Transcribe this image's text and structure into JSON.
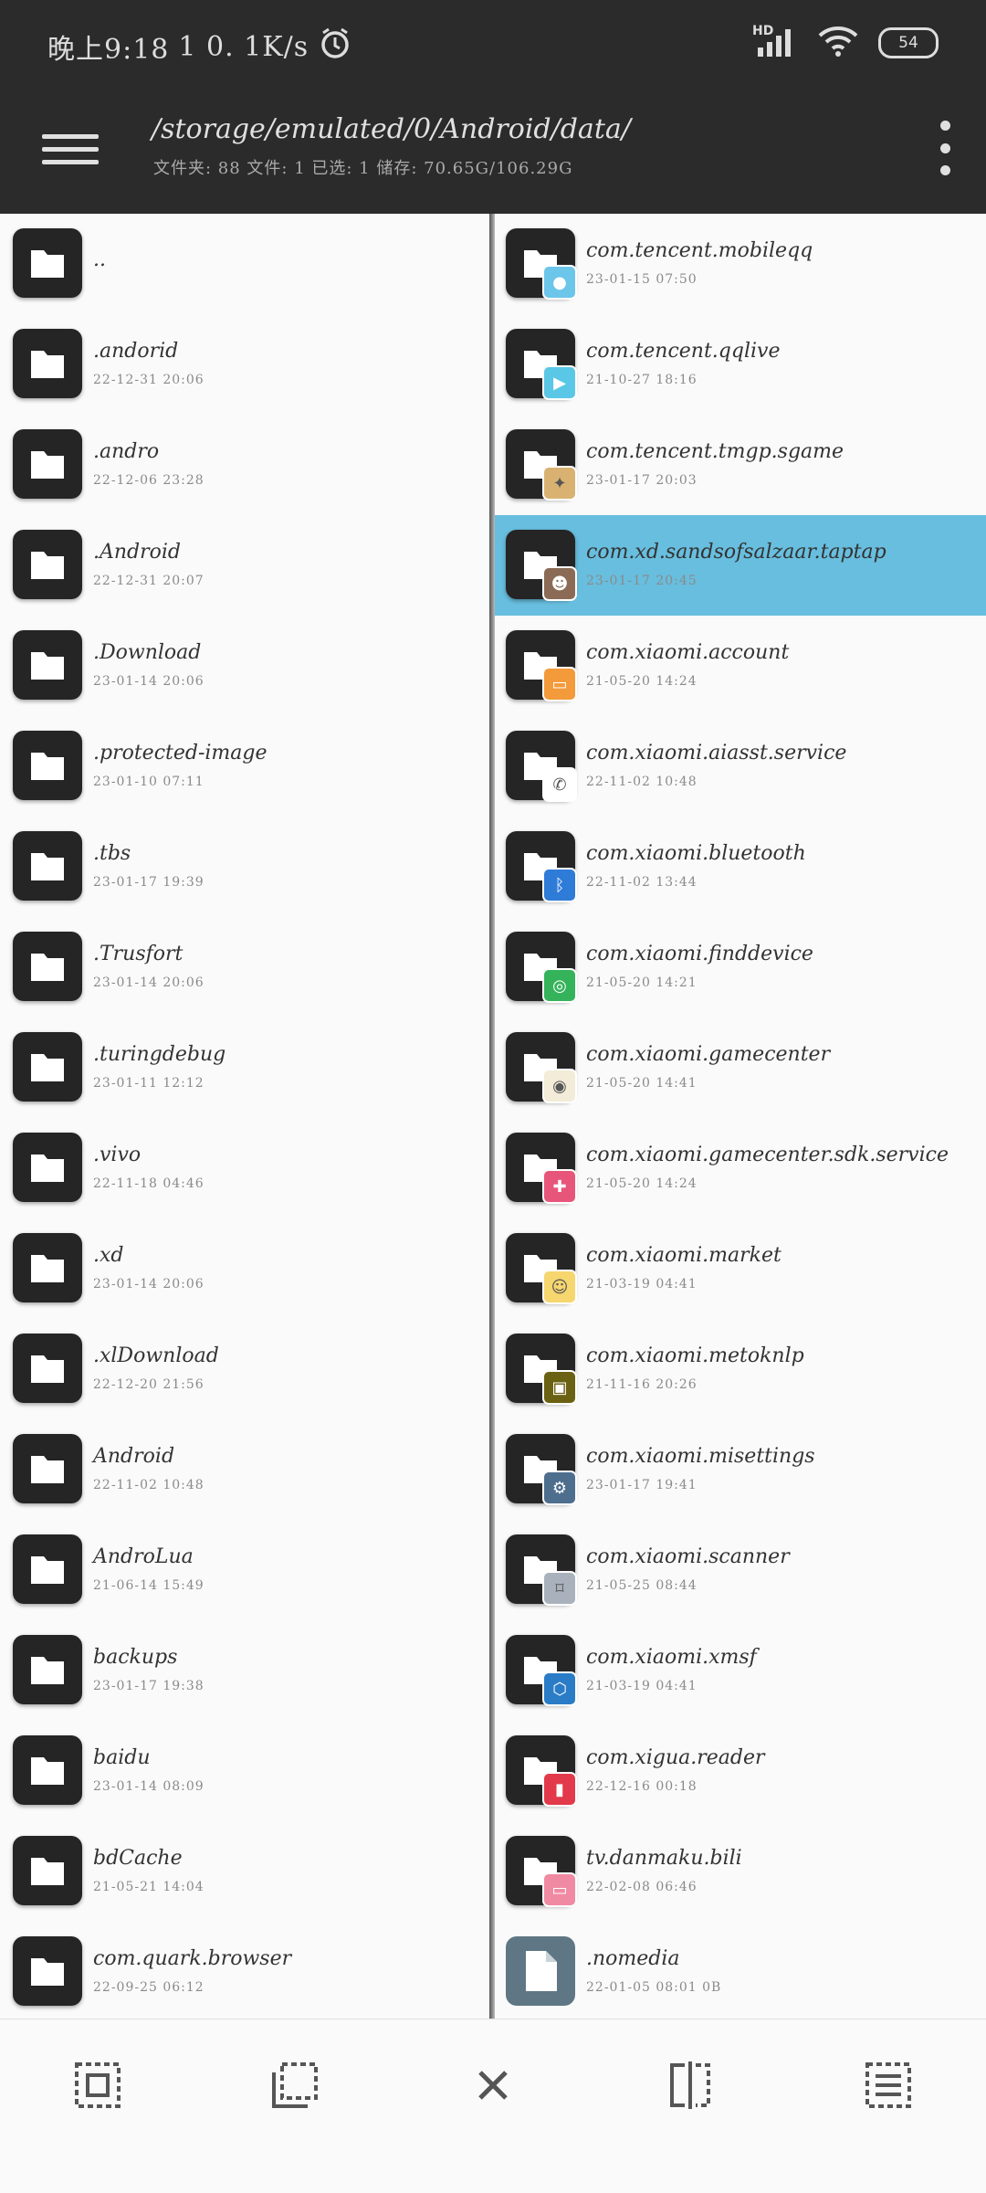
{
  "status_bar": {
    "time": "晚上9:18",
    "speed": "1 0. 1K/s",
    "signal_label": "HD",
    "battery": "54"
  },
  "header": {
    "path": "/storage/emulated/0/Android/data/",
    "stats": "文件夹: 88  文件: 1  已选: 1  储存: 70.65G/106.29G"
  },
  "left_pane": [
    {
      "name": "..",
      "date": ""
    },
    {
      "name": ".andorid",
      "date": "22-12-31 20:06"
    },
    {
      "name": ".andro",
      "date": "22-12-06 23:28"
    },
    {
      "name": ".Android",
      "date": "22-12-31 20:07"
    },
    {
      "name": ".Download",
      "date": "23-01-14 20:06"
    },
    {
      "name": ".protected-image",
      "date": "23-01-10 07:11"
    },
    {
      "name": ".tbs",
      "date": "23-01-17 19:39"
    },
    {
      "name": ".Trusfort",
      "date": "23-01-14 20:06"
    },
    {
      "name": ".turingdebug",
      "date": "23-01-11 12:12"
    },
    {
      "name": ".vivo",
      "date": "22-11-18 04:46"
    },
    {
      "name": ".xd",
      "date": "23-01-14 20:06"
    },
    {
      "name": ".xlDownload",
      "date": "22-12-20 21:56"
    },
    {
      "name": "Android",
      "date": "22-11-02 10:48"
    },
    {
      "name": "AndroLua",
      "date": "21-06-14 15:49"
    },
    {
      "name": "backups",
      "date": "23-01-17 19:38"
    },
    {
      "name": "baidu",
      "date": "23-01-14 08:09"
    },
    {
      "name": "bdCache",
      "date": "21-05-21 14:04"
    },
    {
      "name": "com.quark.browser",
      "date": "22-09-25 06:12"
    }
  ],
  "right_pane": [
    {
      "name": "com.tencent.mobileqq",
      "date": "23-01-15 07:50",
      "badge_color": "#6cc6ea",
      "badge_icon": "penguin-icon",
      "badge_glyph": "●"
    },
    {
      "name": "com.tencent.qqlive",
      "date": "21-10-27 18:16",
      "badge_color": "#5bc7e6",
      "badge_icon": "play-icon",
      "badge_glyph": "▶"
    },
    {
      "name": "com.tencent.tmgp.sgame",
      "date": "23-01-17 20:03",
      "badge_color": "#d9b272",
      "badge_icon": "game-logo-icon",
      "badge_glyph": "✦"
    },
    {
      "name": "com.xd.sandsofsalzaar.taptap",
      "date": "23-01-17 20:45",
      "badge_color": "#8b6b55",
      "badge_icon": "character-icon",
      "badge_glyph": "☻",
      "selected": true
    },
    {
      "name": "com.xiaomi.account",
      "date": "21-05-20 14:24",
      "badge_color": "#f39a3b",
      "badge_icon": "account-card-icon",
      "badge_glyph": "▭"
    },
    {
      "name": "com.xiaomi.aiasst.service",
      "date": "22-11-02 10:48",
      "badge_color": "#ffffff",
      "badge_icon": "phone-assistant-icon",
      "badge_glyph": "✆"
    },
    {
      "name": "com.xiaomi.bluetooth",
      "date": "22-11-02 13:44",
      "badge_color": "#2f7bd8",
      "badge_icon": "bluetooth-icon",
      "badge_glyph": "ᛒ"
    },
    {
      "name": "com.xiaomi.finddevice",
      "date": "21-05-20 14:21",
      "badge_color": "#34b35a",
      "badge_icon": "radar-icon",
      "badge_glyph": "◎"
    },
    {
      "name": "com.xiaomi.gamecenter",
      "date": "21-05-20 14:41",
      "badge_color": "#f2ecd8",
      "badge_icon": "gamepad-icon",
      "badge_glyph": "◉"
    },
    {
      "name": "com.xiaomi.gamecenter.sdk.service",
      "date": "21-05-20 14:24",
      "badge_color": "#e8557a",
      "badge_icon": "controller-icon",
      "badge_glyph": "✚"
    },
    {
      "name": "com.xiaomi.market",
      "date": "21-03-19 04:41",
      "badge_color": "#f6d66e",
      "badge_icon": "market-icon",
      "badge_glyph": "☺"
    },
    {
      "name": "com.xiaomi.metoknlp",
      "date": "21-11-16 20:26",
      "badge_color": "#6b6112",
      "badge_icon": "android-robot-icon",
      "badge_glyph": "▣"
    },
    {
      "name": "com.xiaomi.misettings",
      "date": "23-01-17 19:41",
      "badge_color": "#4e6e8e",
      "badge_icon": "gear-icon",
      "badge_glyph": "⚙"
    },
    {
      "name": "com.xiaomi.scanner",
      "date": "21-05-25 08:44",
      "badge_color": "#a9b2bc",
      "badge_icon": "scanner-icon",
      "badge_glyph": "⌑"
    },
    {
      "name": "com.xiaomi.xmsf",
      "date": "21-03-19 04:41",
      "badge_color": "#2a7cc7",
      "badge_icon": "service-icon",
      "badge_glyph": "⬡"
    },
    {
      "name": "com.xigua.reader",
      "date": "22-12-16 00:18",
      "badge_color": "#e23a4a",
      "badge_icon": "reader-icon",
      "badge_glyph": "▮"
    },
    {
      "name": "tv.danmaku.bili",
      "date": "22-02-08 06:46",
      "badge_color": "#f08aa2",
      "badge_icon": "bilibili-tv-icon",
      "badge_glyph": "▭"
    },
    {
      "name": ".nomedia",
      "date": "22-01-05 08:01  0B",
      "is_file": true
    }
  ],
  "toolbar": [
    "select-all-icon",
    "select-range-icon",
    "close-icon",
    "split-view-icon",
    "list-icon"
  ]
}
